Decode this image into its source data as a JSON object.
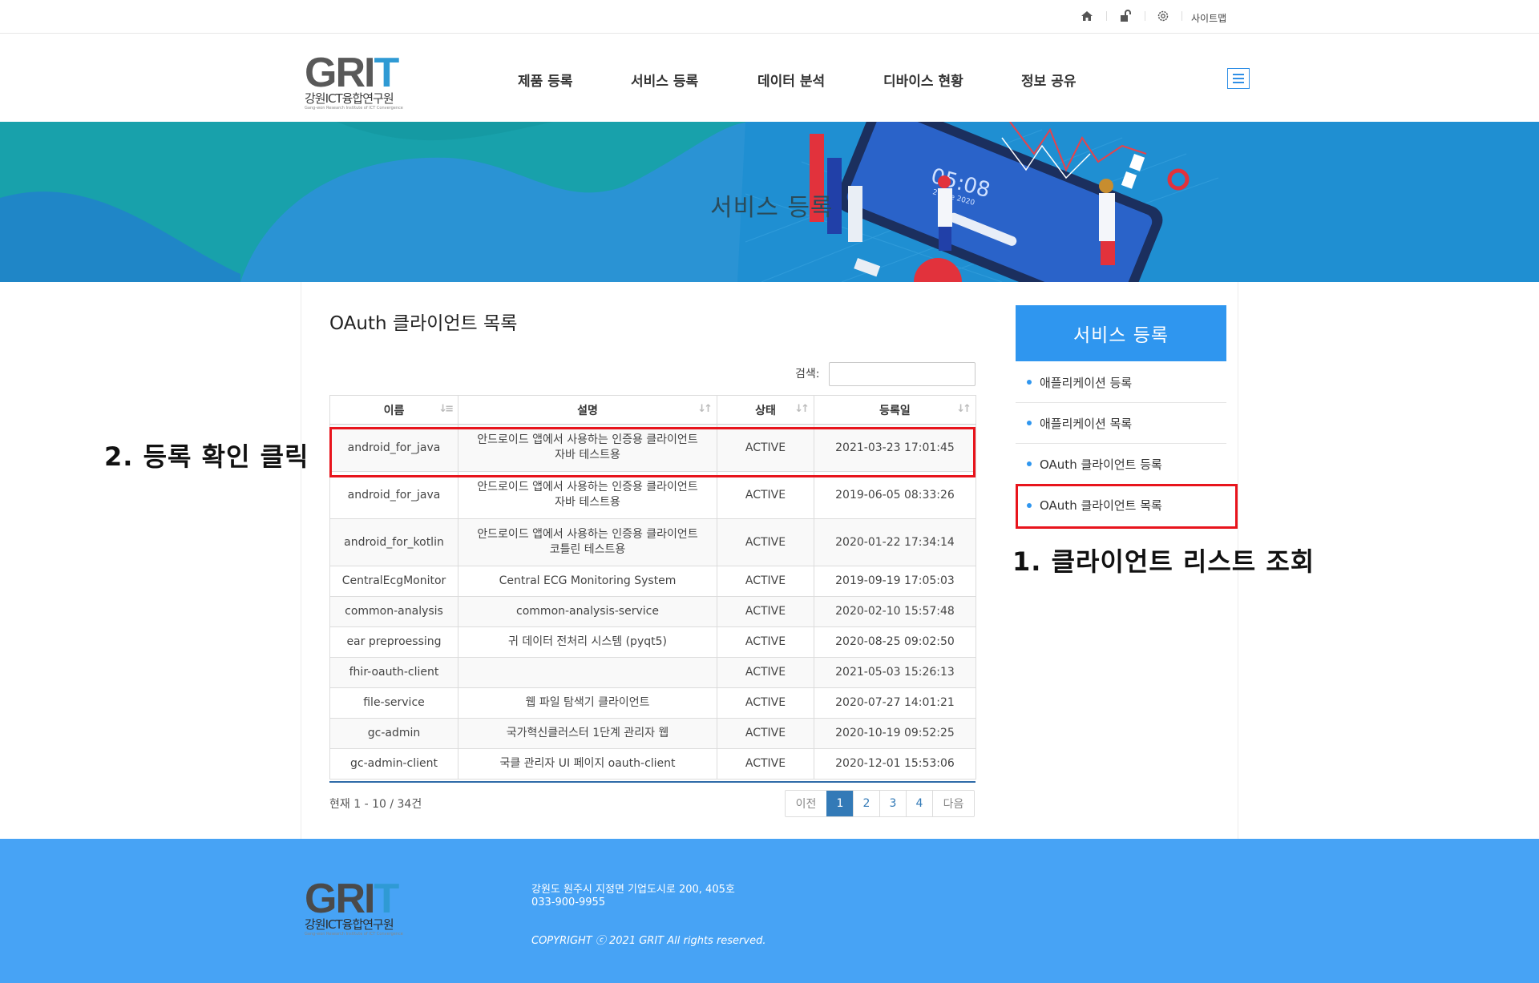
{
  "util_bar": {
    "home_icon": "home-icon",
    "lock_icon": "lock-icon",
    "settings_icon": "gear-icon",
    "sitemap_label": "사이트맵"
  },
  "header": {
    "logo_text_1": "GRI",
    "logo_text_2": "T",
    "logo_sub": "강원ICT융합연구원",
    "logo_tiny": "Gang-won Research Institute of ICT Convergence",
    "nav": [
      "제품 등록",
      "서비스 등록",
      "데이터 분석",
      "디바이스 현황",
      "정보 공유"
    ],
    "menu_icon": "hamburger-icon"
  },
  "banner": {
    "title": "서비스 등록",
    "phone_time": "05:08",
    "phone_date": "2 June 2020"
  },
  "main": {
    "title": "OAuth 클라이언트 목록",
    "search_label": "검색:",
    "search_value": "",
    "columns": [
      "이름",
      "설명",
      "상태",
      "등록일"
    ],
    "rows": [
      {
        "name": "android_for_java",
        "desc1": "안드로이드 앱에서 사용하는 인증용 클라이언트",
        "desc2": "자바 테스트용",
        "status": "ACTIVE",
        "date": "2021-03-23 17:01:45"
      },
      {
        "name": "android_for_java",
        "desc1": "안드로이드 앱에서 사용하는 인증용 클라이언트",
        "desc2": "자바 테스트용",
        "status": "ACTIVE",
        "date": "2019-06-05 08:33:26"
      },
      {
        "name": "android_for_kotlin",
        "desc1": "안드로이드 앱에서 사용하는 인증용 클라이언트",
        "desc2": "코틀린 테스트용",
        "status": "ACTIVE",
        "date": "2020-01-22 17:34:14"
      },
      {
        "name": "CentralEcgMonitor",
        "desc1": "Central ECG Monitoring System",
        "desc2": "",
        "status": "ACTIVE",
        "date": "2019-09-19 17:05:03"
      },
      {
        "name": "common-analysis",
        "desc1": "common-analysis-service",
        "desc2": "",
        "status": "ACTIVE",
        "date": "2020-02-10 15:57:48"
      },
      {
        "name": "ear preproessing",
        "desc1": "귀 데이터 전처리 시스템 (pyqt5)",
        "desc2": "",
        "status": "ACTIVE",
        "date": "2020-08-25 09:02:50"
      },
      {
        "name": "fhir-oauth-client",
        "desc1": "",
        "desc2": "",
        "status": "ACTIVE",
        "date": "2021-05-03 15:26:13"
      },
      {
        "name": "file-service",
        "desc1": "웹 파일 탐색기 클라이언트",
        "desc2": "",
        "status": "ACTIVE",
        "date": "2020-07-27 14:01:21"
      },
      {
        "name": "gc-admin",
        "desc1": "국가혁신클러스터 1단계 관리자 웹",
        "desc2": "",
        "status": "ACTIVE",
        "date": "2020-10-19 09:52:25"
      },
      {
        "name": "gc-admin-client",
        "desc1": "국클 관리자 UI 페이지 oauth-client",
        "desc2": "",
        "status": "ACTIVE",
        "date": "2020-12-01 15:53:06"
      }
    ],
    "summary": "현재 1 - 10 / 34건",
    "pager": {
      "prev": "이전",
      "pages": [
        "1",
        "2",
        "3",
        "4"
      ],
      "next": "다음"
    }
  },
  "sidebar": {
    "title": "서비스 등록",
    "items": [
      "애플리케이션 등록",
      "애플리케이션 목록",
      "OAuth 클라이언트 등록",
      "OAuth 클라이언트 목록"
    ]
  },
  "annotations": {
    "step1": "1. 클라이언트 리스트 조회",
    "step2": "2. 등록 확인 클릭"
  },
  "footer": {
    "address": "강원도 원주시 지정면 기업도시로 200, 405호",
    "phone": "033-900-9955",
    "copyright": "COPYRIGHT ⓒ 2021 GRIT All rights reserved."
  },
  "colors": {
    "accent": "#2f96ef",
    "footer": "#47a3f5",
    "banner": "#1ba3ad",
    "highlight": "#e8141c"
  }
}
